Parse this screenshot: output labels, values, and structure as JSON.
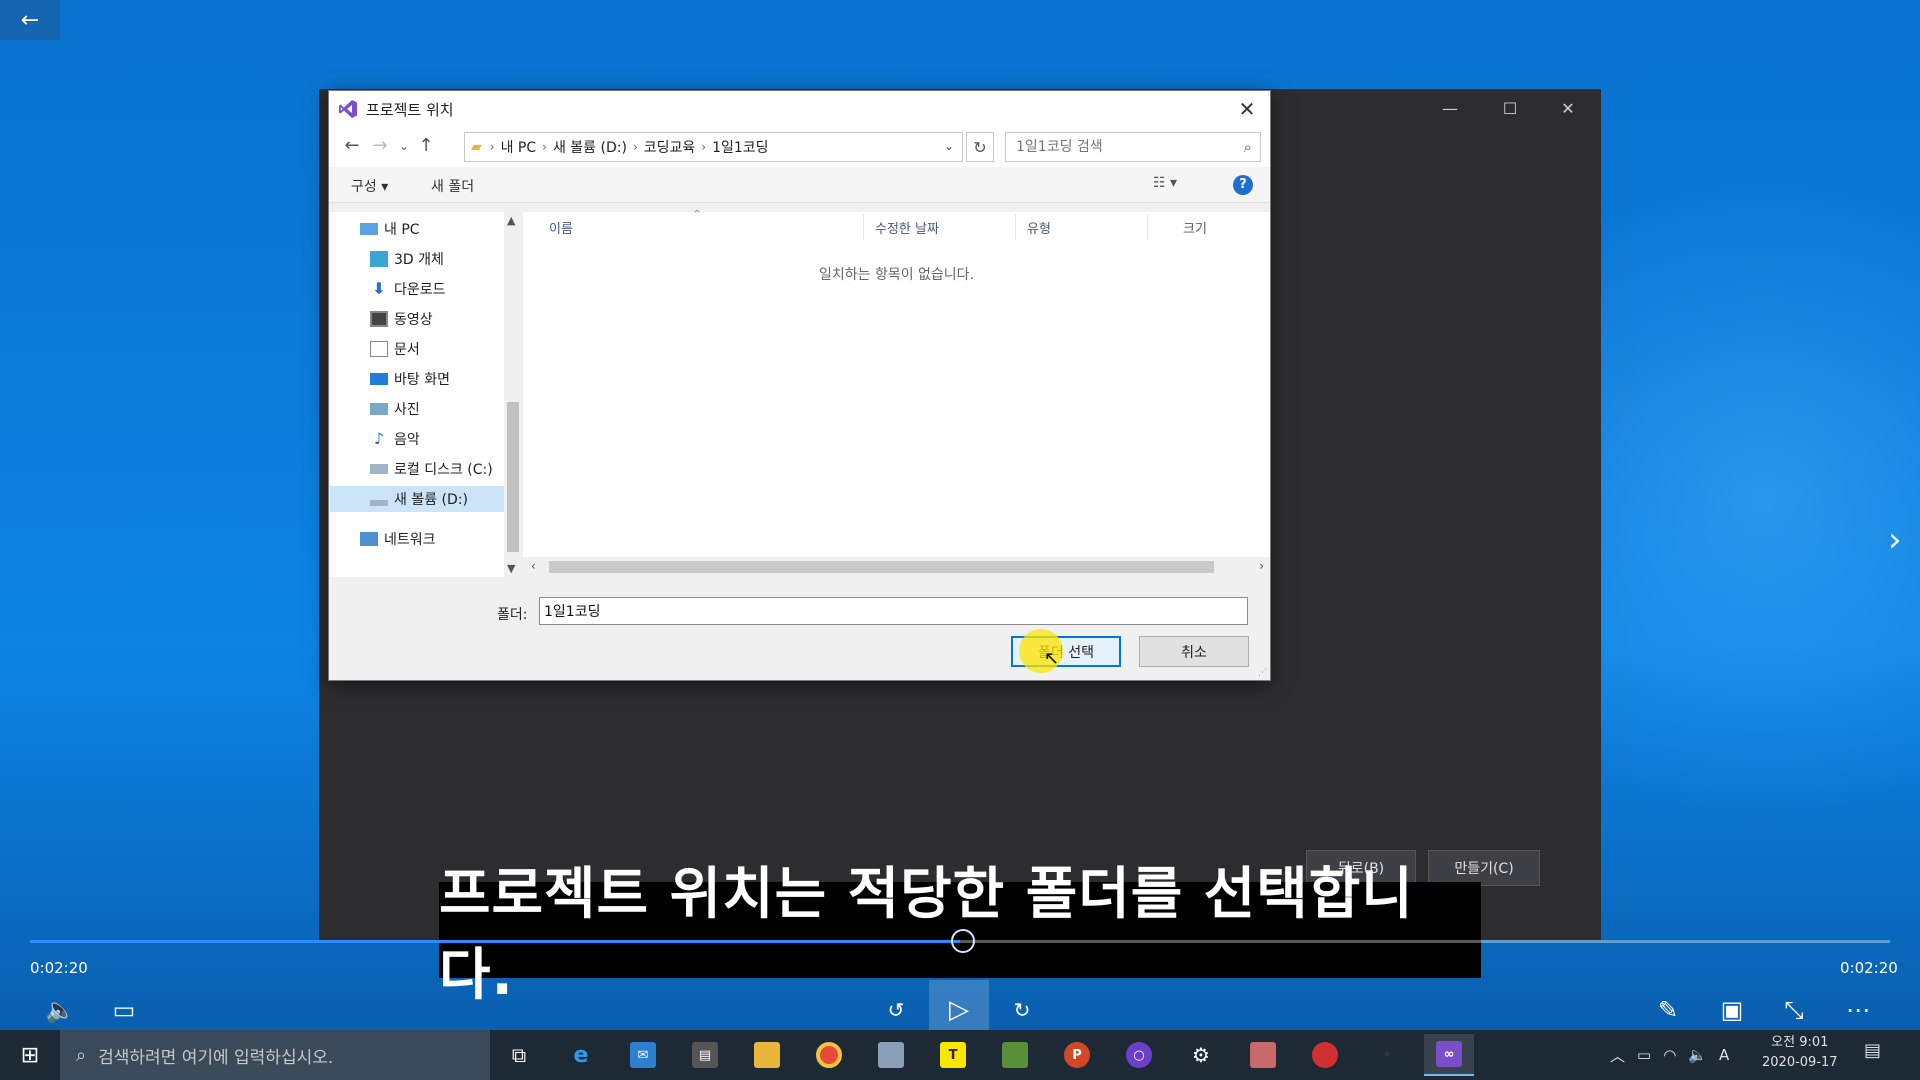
{
  "dialog": {
    "title": "프로젝트 위치",
    "close_label": "✕",
    "address": [
      "내 PC",
      "새 볼륨 (D:)",
      "코딩교육",
      "1일1코딩"
    ],
    "search_placeholder": "1일1코딩 검색",
    "toolbar": {
      "organize": "구성 ▾",
      "new_folder": "새 폴더",
      "view": "☷ ▾",
      "help": "?"
    },
    "tree": [
      {
        "label": "내 PC",
        "icon": "computer-icon"
      },
      {
        "label": "3D 개체",
        "icon": "3d-objects-icon"
      },
      {
        "label": "다운로드",
        "icon": "download-icon"
      },
      {
        "label": "동영상",
        "icon": "video-icon"
      },
      {
        "label": "문서",
        "icon": "document-icon"
      },
      {
        "label": "바탕 화면",
        "icon": "desktop-icon"
      },
      {
        "label": "사진",
        "icon": "picture-icon"
      },
      {
        "label": "음악",
        "icon": "music-icon"
      },
      {
        "label": "로컬 디스크 (C:)",
        "icon": "drive-icon"
      },
      {
        "label": "새 볼륨 (D:)",
        "icon": "drive-icon",
        "selected": true
      },
      {
        "label": "네트워크",
        "icon": "network-icon"
      }
    ],
    "columns": [
      "이름",
      "수정한 날짜",
      "유형",
      "크기"
    ],
    "empty_message": "일치하는 항목이 없습니다.",
    "folder_label": "폴더:",
    "folder_value": "1일1코딩",
    "select_folder": "폴더 선택",
    "cancel": "취소"
  },
  "vs_window": {
    "back_button": "뒤로(B)",
    "create_button": "만들기(C)"
  },
  "subtitle": "프로젝트 위치는 적당한 폴더를 선택합니다.",
  "player": {
    "time_left": "0:02:20",
    "time_right": "0:02:20",
    "progress_fraction": 0.5
  },
  "taskbar": {
    "search_placeholder": "검색하려면 여기에 입력하십시오.",
    "time": "오전 9:01",
    "date": "2020-09-17",
    "ime": "A"
  },
  "colors": {
    "accent": "#0078d7",
    "desktop": "#0b7ad8",
    "vs_dark": "#2d2d30"
  }
}
